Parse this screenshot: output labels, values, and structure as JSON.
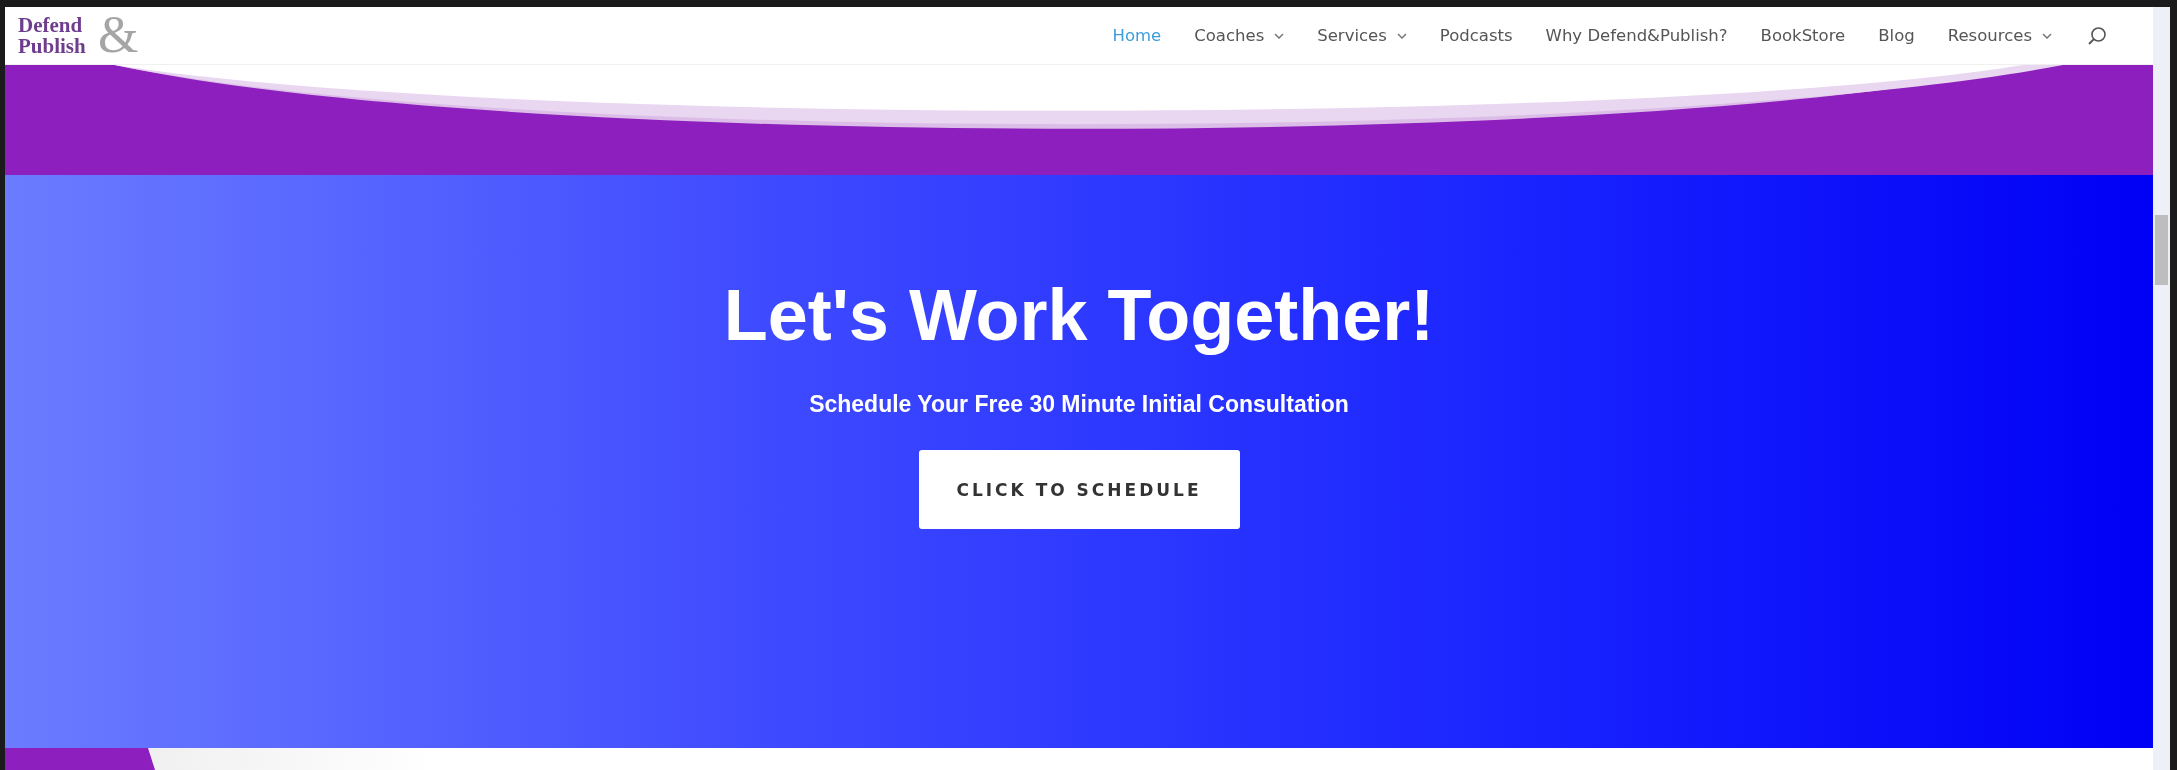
{
  "logo": {
    "line_1": "Defend",
    "line_2": "Publish",
    "ampersand": "&"
  },
  "nav": [
    {
      "label": "Home",
      "selected": true,
      "dropdown": false
    },
    {
      "label": "Coaches",
      "selected": false,
      "dropdown": true
    },
    {
      "label": "Services",
      "selected": false,
      "dropdown": true
    },
    {
      "label": "Podcasts",
      "selected": false,
      "dropdown": false
    },
    {
      "label": "Why Defend&Publish?",
      "selected": false,
      "dropdown": false
    },
    {
      "label": "BookStore",
      "selected": false,
      "dropdown": false
    },
    {
      "label": "Blog",
      "selected": false,
      "dropdown": false
    },
    {
      "label": "Resources",
      "selected": false,
      "dropdown": true
    }
  ],
  "hero": {
    "title": "Let's Work Together!",
    "subtitle": "Schedule Your Free 30 Minute Initial Consultation",
    "button": "CLICK TO SCHEDULE"
  }
}
